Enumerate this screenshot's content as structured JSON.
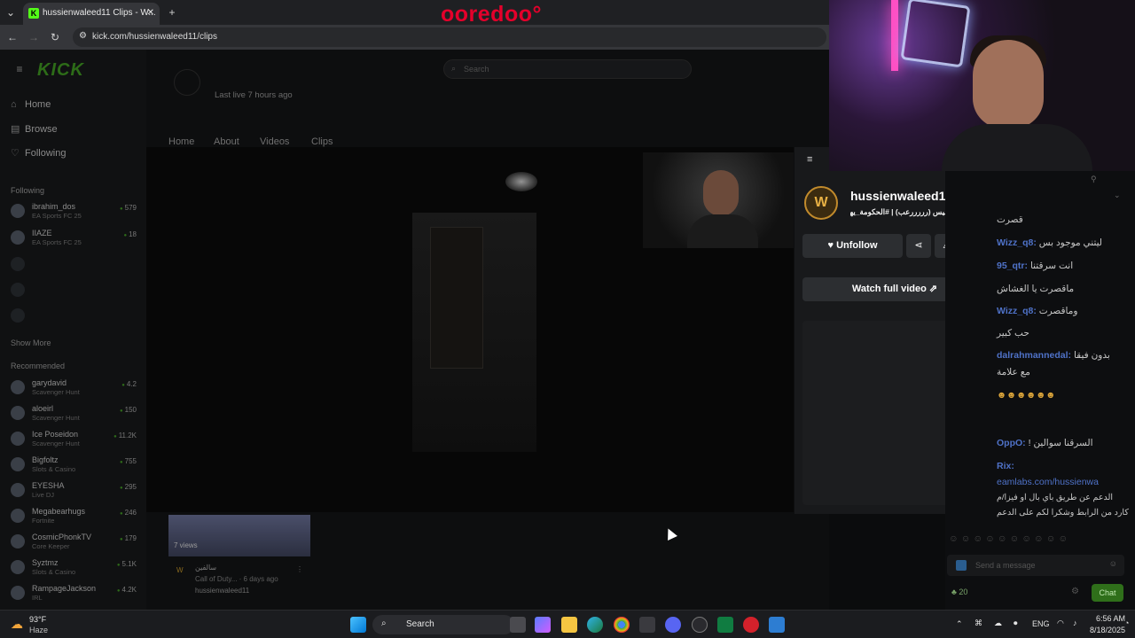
{
  "browser": {
    "tab_title": "hussienwaleed11 Clips - W...",
    "url": "kick.com/hussienwaleed11/clips",
    "isp_logo": "ooredoo°"
  },
  "kick": {
    "search_placeholder": "Search",
    "nav": [
      "Home",
      "Browse",
      "Following"
    ],
    "following_header": "Following",
    "following": [
      {
        "name": "ibrahim_dos",
        "category": "EA Sports FC 25",
        "viewers": "579"
      },
      {
        "name": "IIAZE",
        "category": "EA Sports FC 25",
        "viewers": "18"
      }
    ],
    "show_more": "Show More",
    "recommended_header": "Recommended",
    "recommended": [
      {
        "name": "garydavid",
        "category": "Scavenger Hunt",
        "viewers": "4.2"
      },
      {
        "name": "aloeirl",
        "category": "Scavenger Hunt",
        "viewers": "150"
      },
      {
        "name": "Ice Poseidon",
        "category": "Scavenger Hunt",
        "viewers": "11.2K"
      },
      {
        "name": "Bigfoltz",
        "category": "Slots & Casino",
        "viewers": "755"
      },
      {
        "name": "EYESHA",
        "category": "Live DJ",
        "viewers": "295"
      },
      {
        "name": "Megabearhugs",
        "category": "Fortnite",
        "viewers": "246"
      },
      {
        "name": "CosmicPhonkTV",
        "category": "Core Keeper",
        "viewers": "179"
      },
      {
        "name": "Syztmz",
        "category": "Slots & Casino",
        "viewers": "5.1K"
      },
      {
        "name": "RampageJackson",
        "category": "IRL",
        "viewers": "4.2K"
      }
    ],
    "last_live": "Last live 7 hours ago",
    "profile_tabs": [
      "Home",
      "About",
      "Videos",
      "Clips"
    ],
    "thumb_views": "7 views",
    "thumb_title": "سالفين",
    "thumb_meta": "Call of Duty... · 6 days ago",
    "thumb_channel": "hussienwaleed11"
  },
  "clip_panel": {
    "channel_name": "hussienwaleed11",
    "clip_title": "نلعب لعبة ابليس (رررررعب) | #الحكومة_يهد",
    "unfollow_label": "Unfollow",
    "watch_full_label": "Watch full video"
  },
  "chat": {
    "messages": [
      {
        "user": "",
        "text": "قصرت"
      },
      {
        "user": "Wizz_q8:",
        "text": "ليتني موجود بس"
      },
      {
        "user": "95_qtr:",
        "text": "انت سرقتنا"
      },
      {
        "user": "",
        "text": "ماقصرت يا الغشاش"
      },
      {
        "user": "Wizz_q8:",
        "text": "وماقصرت"
      },
      {
        "user": "",
        "text": "حب كبير"
      },
      {
        "user": "dalrahmannedal:",
        "text": "بدون فيقا"
      },
      {
        "user": "",
        "text": "مع علامة"
      },
      {
        "user": "OppO:",
        "text": "! السرقنا سوالين"
      },
      {
        "user": "Rix:",
        "text": ""
      },
      {
        "user": "",
        "text": "eamlabs.com/hussienwa"
      },
      {
        "user": "",
        "text": "الدعم عن طريق باي بال او فيزا/م"
      },
      {
        "user": "",
        "text": "كارد من الرابط وشكرا لكم على الدعم"
      }
    ],
    "input_placeholder": "Send a message",
    "points": "20",
    "send_label": "Chat"
  },
  "taskbar": {
    "weather_temp": "93°F",
    "weather_desc": "Haze",
    "search_label": "Search",
    "lang": "ENG",
    "time": "6:56 AM",
    "date": "8/18/2025"
  }
}
